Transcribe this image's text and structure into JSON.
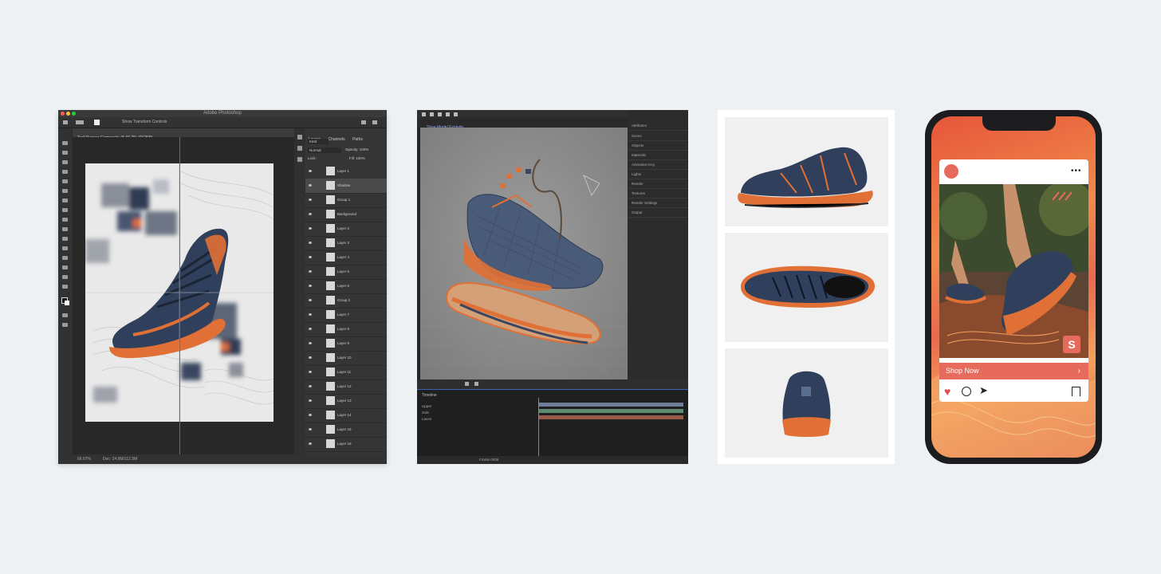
{
  "photoshop": {
    "window_title": "Adobe Photoshop",
    "document_tab": "Trail Runner Composite @ 66.7% (RGB/8)",
    "options_label": "Show Transform Controls",
    "status_zoom": "66.67%",
    "status_doc": "Doc: 24.6M/112.5M",
    "panel_tabs": [
      "Layers",
      "Channels",
      "Paths"
    ],
    "blend_mode": "Normal",
    "opacity_label": "Opacity: 100%",
    "lock_label": "Lock:",
    "fill_label": "Fill: 100%",
    "layers": [
      {
        "name": "Layer 1"
      },
      {
        "name": "Shadow"
      },
      {
        "name": "Group 1"
      },
      {
        "name": "Background"
      },
      {
        "name": "Layer 2"
      },
      {
        "name": "Layer 3"
      },
      {
        "name": "Layer 4"
      },
      {
        "name": "Layer 5"
      },
      {
        "name": "Layer 6"
      },
      {
        "name": "Group 2"
      },
      {
        "name": "Layer 7"
      },
      {
        "name": "Layer 8"
      },
      {
        "name": "Layer 9"
      },
      {
        "name": "Layer 10"
      },
      {
        "name": "Layer 11"
      },
      {
        "name": "Layer 12"
      },
      {
        "name": "Layer 13"
      },
      {
        "name": "Layer 14"
      },
      {
        "name": "Layer 15"
      },
      {
        "name": "Layer 16"
      },
      {
        "name": "Layer 17"
      }
    ]
  },
  "modeler": {
    "project_label": "Shoe Model Explode",
    "menu_items": [
      "Scene",
      "Objects",
      "Materials",
      "Animation Key",
      "Lights",
      "Render",
      "Textures",
      "Render Settings",
      "Output"
    ],
    "menu_header": "Attributes",
    "timeline_label": "Timeline",
    "timeline_tracks": [
      "Upper",
      "Sole",
      "Laces"
    ],
    "frame_label": "Frame 0036"
  },
  "product_views": {
    "views": [
      "side",
      "top",
      "back"
    ]
  },
  "social_post": {
    "cta": "Shop Now",
    "brand_badge": "S",
    "more_icon": "more-icon",
    "colors": {
      "accent": "#e66b5c",
      "heart": "#e24b4b"
    }
  },
  "colors": {
    "navy": "#2f3f5c",
    "orange": "#e07035",
    "ps_bg": "#2b2b2b"
  }
}
